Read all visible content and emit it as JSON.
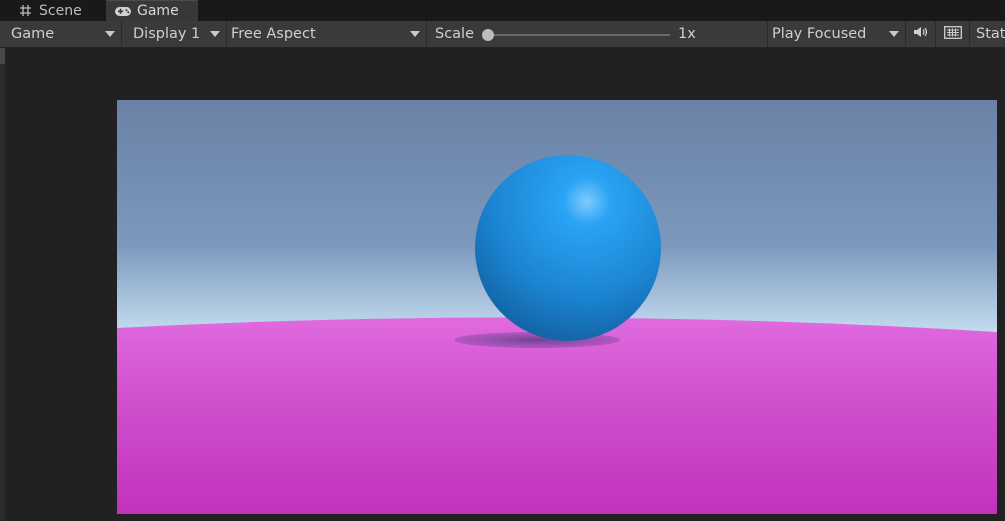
{
  "tabs": {
    "scene_label": "Scene",
    "game_label": "Game"
  },
  "toolbar": {
    "view_mode": "Game",
    "display": "Display 1",
    "aspect": "Free Aspect",
    "scale_label": "Scale",
    "scale_value": "1x",
    "play_mode": "Play Focused",
    "stats_label": "Stat"
  },
  "colors": {
    "toolbar_bg": "#3a3a3a",
    "tab_active_bg": "#383838",
    "sky_top": "#6a82a6",
    "horizon": "#f4fbff",
    "ground": "#cc44c4",
    "sphere": "#1e8fe0"
  },
  "icons": {
    "scene_tab": "grid-hash-icon",
    "game_tab": "gamepad-icon",
    "audio": "speaker-icon",
    "keyboard": "keyboard-icon"
  }
}
